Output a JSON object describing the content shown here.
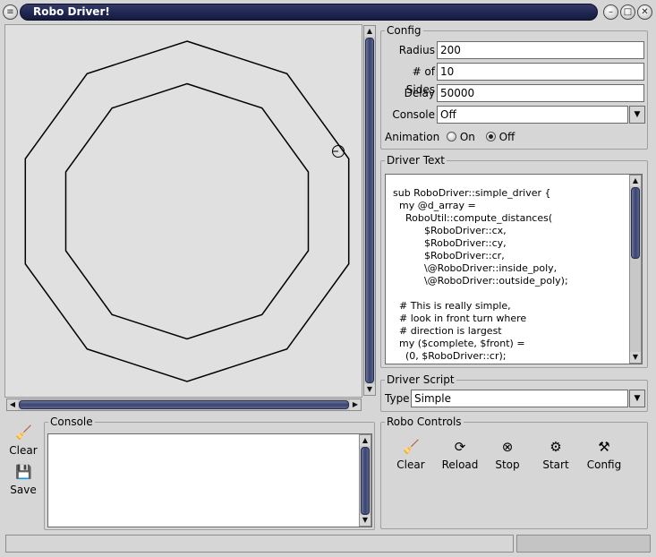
{
  "window": {
    "title": "Robo Driver!"
  },
  "config": {
    "label": "Config",
    "radius_label": "Radius",
    "radius_value": "200",
    "sides_label": "# of Sides",
    "sides_value": "10",
    "delay_label": "Delay",
    "delay_value": "50000",
    "console_label": "Console",
    "console_value": "Off",
    "animation_label": "Animation",
    "anim_on_label": "On",
    "anim_off_label": "Off",
    "animation_selected": "Off"
  },
  "driver_text": {
    "label": "Driver Text",
    "lines": [
      "sub RoboDriver::simple_driver {",
      "  my @d_array =",
      "    RoboUtil::compute_distances(",
      "          $RoboDriver::cx,",
      "          $RoboDriver::cy,",
      "          $RoboDriver::cr,",
      "          \\@RoboDriver::inside_poly,",
      "          \\@RoboDriver::outside_poly);",
      "",
      "  # This is really simple,",
      "  # look in front turn where",
      "  # direction is largest",
      "  my ($complete, $front) =",
      "    (0, $RoboDriver::cr);"
    ]
  },
  "driver_script": {
    "label": "Driver Script",
    "type_label": "Type",
    "type_value": "Simple"
  },
  "robo_controls": {
    "label": "Robo Controls",
    "clear": "Clear",
    "reload": "Reload",
    "stop": "Stop",
    "start": "Start",
    "config": "Config"
  },
  "console": {
    "label": "Console",
    "clear": "Clear",
    "save": "Save"
  },
  "track": {
    "sides": 10,
    "outer_radius": 200,
    "inner_radius": 150
  },
  "icons": {
    "window_menu": "menu-icon",
    "minimize": "minimize-icon",
    "maximize": "maximize-icon",
    "close": "close-icon",
    "clear": "broom-icon",
    "save": "floppy-icon",
    "reload": "reload-icon",
    "stop": "stop-icon",
    "start": "gear-icon",
    "config": "config-icon"
  }
}
